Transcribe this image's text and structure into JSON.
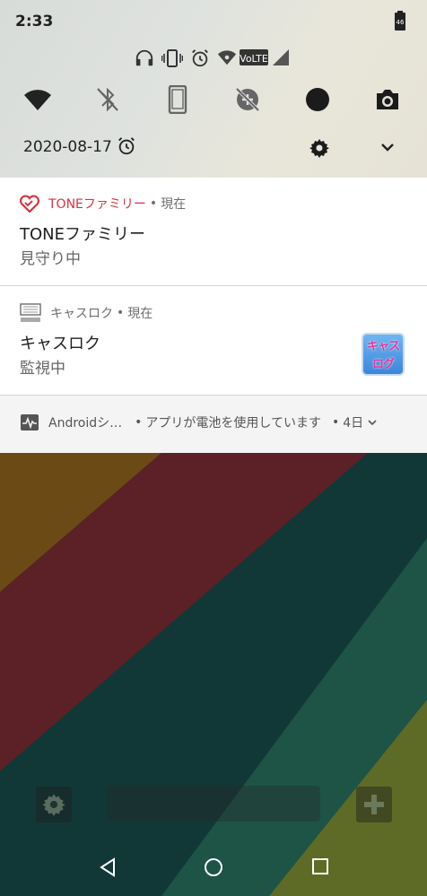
{
  "status_bar": {
    "time": "2:33",
    "battery_level": "46",
    "network_label": "VoLTE"
  },
  "quick_settings": {
    "date": "2020-08-17",
    "tiles": [
      "wifi-icon",
      "bluetooth-off-icon",
      "phone-rotate-icon",
      "data-saver-off-icon",
      "dark-mode-icon",
      "screenshot-camera-icon"
    ]
  },
  "notifications": [
    {
      "app": "TONEファミリー",
      "separator": "•",
      "time": "現在",
      "title": "TONEファミリー",
      "body": "見守り中",
      "accent": "#d9333f"
    },
    {
      "app": "キャスロク",
      "separator": "•",
      "time": "現在",
      "title": "キャスロク",
      "body": "監視中",
      "thumb_line1": "キャス",
      "thumb_line2": "ログ"
    },
    {
      "app": "Androidシ…",
      "separator1": "•",
      "message": "アプリが電池を使用しています",
      "separator2": "•",
      "time": "4日"
    }
  ],
  "colors": {
    "stripe_brown": "#6b4a16",
    "stripe_red": "#5b2126",
    "stripe_teal": "#113837",
    "stripe_green": "#1d5446",
    "stripe_olive": "#5e6b26"
  }
}
